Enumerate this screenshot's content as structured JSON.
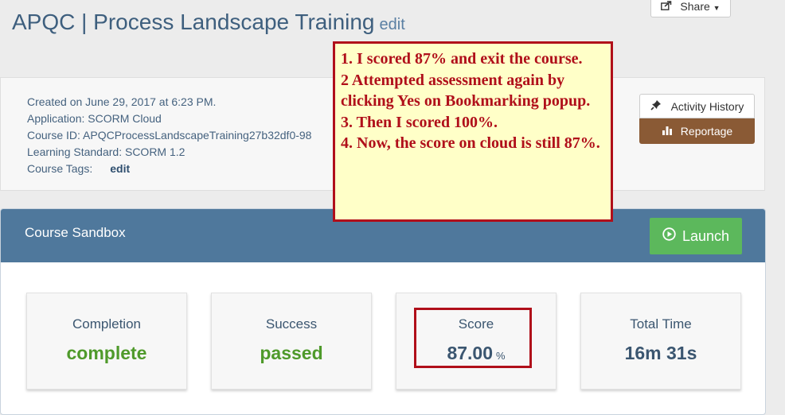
{
  "page": {
    "title": "APQC | Process Landscape Training",
    "title_edit": "edit",
    "share_label": "Share"
  },
  "info": {
    "created": "Created on June 29, 2017 at 6:23 PM.",
    "application": "Application: SCORM Cloud",
    "course_id": "Course ID: APQCProcessLandscapeTraining27b32df0-98",
    "learning_standard": "Learning Standard: SCORM 1.2",
    "course_tags_label": "Course Tags:",
    "course_tags_edit": "edit"
  },
  "actions": {
    "activity_history": "Activity History",
    "reportage": "Reportage"
  },
  "sandbox": {
    "title": "Course Sandbox",
    "launch": "Launch"
  },
  "stats": [
    {
      "label": "Completion",
      "value": "complete"
    },
    {
      "label": "Success",
      "value": "passed"
    },
    {
      "label": "Score",
      "value": "87.00",
      "unit": "%"
    },
    {
      "label": "Total Time",
      "value": "16m 31s"
    }
  ],
  "annotation": {
    "lines": [
      "1. I scored 87% and exit the course.",
      "2 Attempted assessment again by clicking Yes on Bookmarking popup.",
      "3. Then I scored 100%.",
      "4. Now, the score on cloud is still 87%."
    ]
  },
  "colors": {
    "header_blue": "#4f789c",
    "launch_green": "#5cb85c",
    "reportage_brown": "#8a5a35",
    "annotation_red": "#b00f1a",
    "annotation_bg": "#ffffc8"
  },
  "icons": {
    "share": "share-icon",
    "caret": "caret-down-icon",
    "pin": "pushpin-icon",
    "chart": "bar-chart-icon",
    "play": "play-circle-icon"
  }
}
